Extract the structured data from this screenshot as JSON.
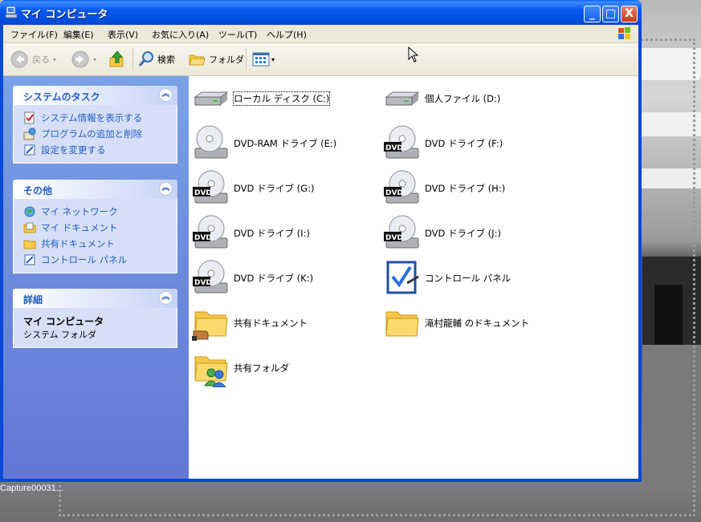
{
  "window": {
    "title": "マイ コンピュータ",
    "min": "_",
    "max": "□",
    "close": "X"
  },
  "menu": [
    "ファイル(F)",
    "編集(E)",
    "表示(V)",
    "お気に入り(A)",
    "ツール(T)",
    "ヘルプ(H)"
  ],
  "toolbar": {
    "back": "戻る",
    "search": "検索",
    "folders": "フォルダ"
  },
  "tasks": {
    "system": {
      "title": "システムのタスク",
      "items": [
        "システム情報を表示する",
        "プログラムの追加と削除",
        "設定を変更する"
      ]
    },
    "other": {
      "title": "その他",
      "items": [
        "マイ ネットワーク",
        "マイ ドキュメント",
        "共有ドキュメント",
        "コントロール パネル"
      ]
    },
    "details": {
      "title": "詳細",
      "name": "マイ コンピュータ",
      "type": "システム フォルダ"
    }
  },
  "items": [
    {
      "label": "ローカル ディスク (C:)",
      "icon": "hard-disk-icon"
    },
    {
      "label": "個人ファイル (D:)",
      "icon": "hard-disk-icon"
    },
    {
      "label": "DVD-RAM ドライブ (E:)",
      "icon": "cd-drive-icon"
    },
    {
      "label": "DVD ドライブ (F:)",
      "icon": "dvd-drive-icon"
    },
    {
      "label": "DVD ドライブ (G:)",
      "icon": "dvd-drive-icon"
    },
    {
      "label": "DVD ドライブ (H:)",
      "icon": "dvd-drive-icon"
    },
    {
      "label": "DVD ドライブ (I:)",
      "icon": "dvd-drive-icon"
    },
    {
      "label": "DVD ドライブ (J:)",
      "icon": "dvd-drive-icon"
    },
    {
      "label": "DVD ドライブ (K:)",
      "icon": "dvd-drive-icon"
    },
    {
      "label": "コントロール パネル",
      "icon": "control-panel-icon"
    },
    {
      "label": "共有ドキュメント",
      "icon": "shared-folder-icon"
    },
    {
      "label": "滝村龍輔 のドキュメント",
      "icon": "folder-icon"
    },
    {
      "label": "共有フォルダ",
      "icon": "users-folder-icon"
    }
  ],
  "capture_label": "Capture00031..."
}
